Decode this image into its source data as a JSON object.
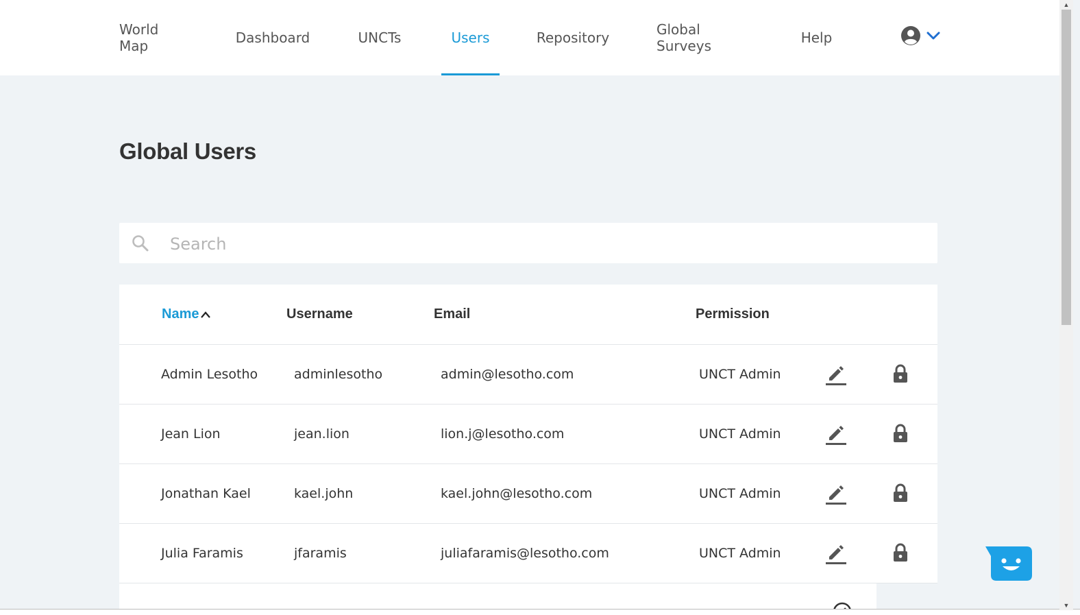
{
  "nav": {
    "items": [
      {
        "label": "World Map",
        "active": false
      },
      {
        "label": "Dashboard",
        "active": false
      },
      {
        "label": "UNCTs",
        "active": false
      },
      {
        "label": "Users",
        "active": true
      },
      {
        "label": "Repository",
        "active": false
      },
      {
        "label": "Global Surveys",
        "active": false
      },
      {
        "label": "Help",
        "active": false
      }
    ],
    "account_icon": "user-circle-icon",
    "account_menu_icon": "chevron-down-icon"
  },
  "page": {
    "title": "Global Users"
  },
  "search": {
    "placeholder": "Search",
    "value": "",
    "icon": "search-icon"
  },
  "table": {
    "headers": {
      "name": "Name",
      "username": "Username",
      "email": "Email",
      "permission": "Permission"
    },
    "sort": {
      "column": "name",
      "direction": "ascending"
    },
    "rows": [
      {
        "name": "Admin Lesotho",
        "username": "adminlesotho",
        "email": "admin@lesotho.com",
        "permission": "UNCT Admin"
      },
      {
        "name": "Jean Lion",
        "username": "jean.lion",
        "email": "lion.j@lesotho.com",
        "permission": "UNCT Admin"
      },
      {
        "name": "Jonathan Kael",
        "username": "kael.john",
        "email": "kael.john@lesotho.com",
        "permission": "UNCT Admin"
      },
      {
        "name": "Julia Faramis",
        "username": "jfaramis",
        "email": "juliafaramis@lesotho.com",
        "permission": "UNCT Admin"
      }
    ],
    "row_actions": {
      "edit_icon": "edit-pencil-icon",
      "lock_icon": "lock-icon"
    }
  },
  "chat_widget": {
    "icon": "chat-smiley-icon"
  },
  "colors": {
    "accent": "#1a9ad6",
    "page_background": "#eff3f6",
    "chat": "#1da1e6"
  }
}
